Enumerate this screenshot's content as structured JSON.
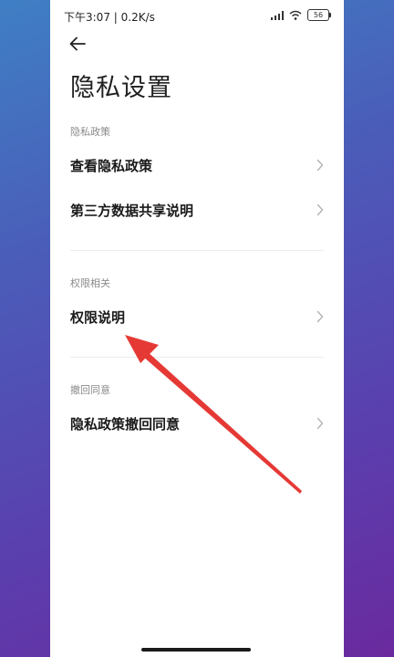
{
  "status_bar": {
    "time_speed": "下午3:07 | 0.2K/s",
    "battery": "56"
  },
  "page": {
    "title": "隐私设置"
  },
  "sections": [
    {
      "header": "隐私政策",
      "items": [
        {
          "label": "查看隐私政策"
        },
        {
          "label": "第三方数据共享说明"
        }
      ]
    },
    {
      "header": "权限相关",
      "items": [
        {
          "label": "权限说明"
        }
      ]
    },
    {
      "header": "撤回同意",
      "items": [
        {
          "label": "隐私政策撤回同意"
        }
      ]
    }
  ],
  "colors": {
    "annotation_arrow": "#e53935",
    "background_gradient_start": "#3f7fc4",
    "background_gradient_end": "#6a2a9e"
  }
}
